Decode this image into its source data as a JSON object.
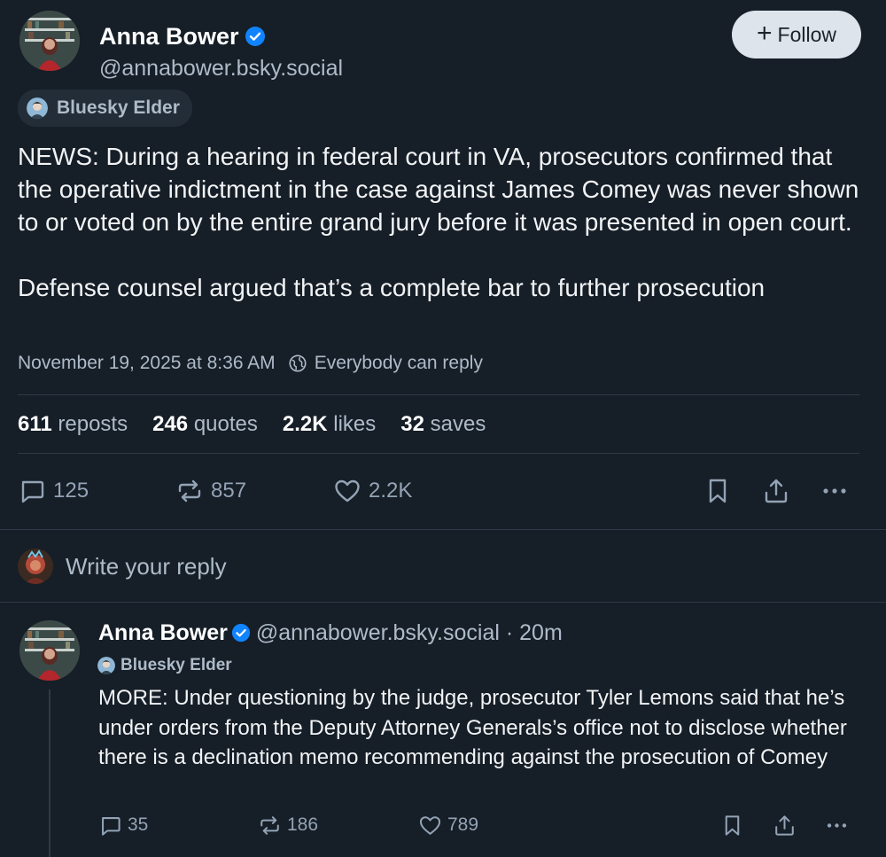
{
  "post": {
    "author_name": "Anna Bower",
    "handle": "@annabower.bsky.social",
    "follow_label": "Follow",
    "badge": "Bluesky Elder",
    "paragraphs": [
      "NEWS: During a hearing in federal court in VA, prosecutors confirmed that the operative indictment in the case against James Comey was never shown to or voted on by the entire grand jury before it was presented in open court.",
      "Defense counsel argued that’s a complete bar to further prosecution"
    ],
    "timestamp": "November 19, 2025 at 8:36 AM",
    "reply_setting": "Everybody can reply",
    "stats": {
      "reposts_count": "611",
      "reposts_label": "reposts",
      "quotes_count": "246",
      "quotes_label": "quotes",
      "likes_count": "2.2K",
      "likes_label": "likes",
      "saves_count": "32",
      "saves_label": "saves"
    },
    "actions": {
      "replies": "125",
      "reposts": "857",
      "likes": "2.2K"
    }
  },
  "composer": {
    "placeholder": "Write your reply"
  },
  "reply": {
    "author_name": "Anna Bower",
    "handle": "@annabower.bsky.social",
    "time": " · 20m",
    "badge": "Bluesky Elder",
    "text": "MORE: Under questioning by the judge, prosecutor Tyler Lemons said that he’s under orders from the Deputy Attorney Generals’s office not to disclose whether there is a declination memo recommending against the prosecution of Comey",
    "actions": {
      "replies": "35",
      "reposts": "186",
      "likes": "789"
    }
  },
  "colors": {
    "background": "#161e27",
    "verified": "#1083fe",
    "muted_text": "#aebbc9",
    "icon": "#93a3b5",
    "follow_button": "#dde4ec"
  }
}
